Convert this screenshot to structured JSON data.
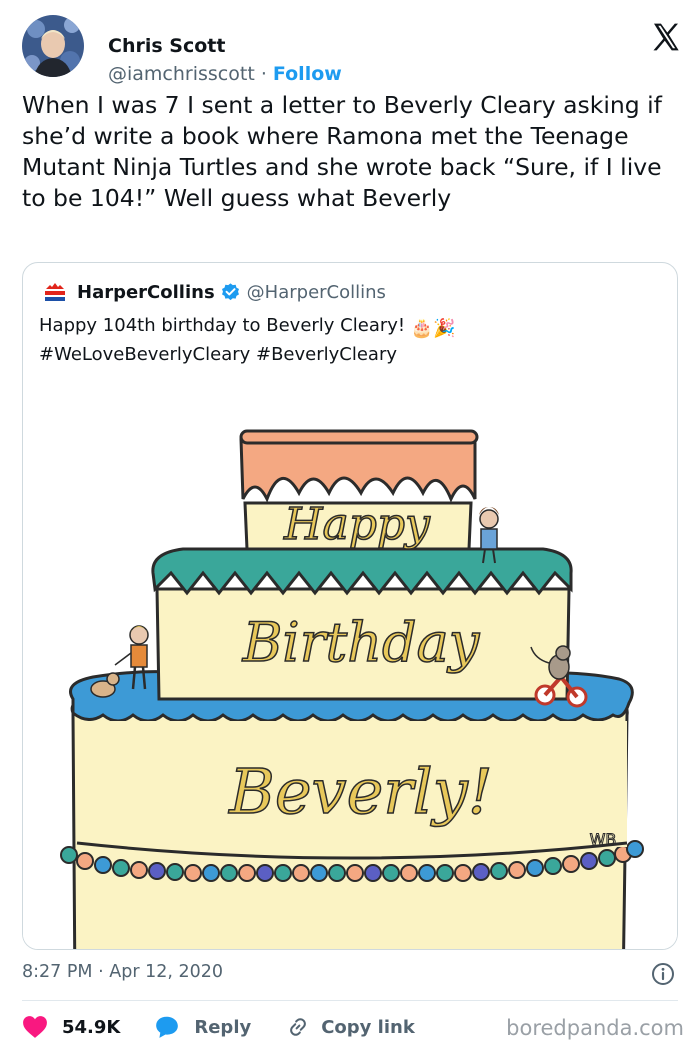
{
  "author": {
    "name": "Chris Scott",
    "handle": "@iamchrisscott",
    "separator": "·",
    "follow_label": "Follow"
  },
  "tweet": {
    "text": "When I was 7 I sent a letter to Beverly Cleary asking if she’d write a book where Ramona met the Teenage Mutant Ninja Turtles and she wrote back “Sure, if I live to be 104!” Well guess what Beverly"
  },
  "quote": {
    "name": "HarperCollins",
    "handle": "@HarperCollins",
    "text_line1": "Happy 104th birthday to Beverly Cleary!",
    "text_line2": "#WeLoveBeverlyCleary #BeverlyCleary",
    "emoji": "🎂🎉",
    "image": {
      "line1": "Happy",
      "line2": "Birthday",
      "line3": "Beverly!",
      "signature": "WB"
    }
  },
  "meta": {
    "time": "8:27 PM",
    "separator": "·",
    "date": "Apr 12, 2020"
  },
  "actions": {
    "like_count": "54.9K",
    "reply_label": "Reply",
    "copy_label": "Copy link"
  },
  "watermark": "boredpanda.com",
  "colors": {
    "like": "#f91880",
    "reply": "#1d9bf0",
    "follow": "#1d9bf0",
    "cake_top": "#f4a882",
    "cake_middle": "#3aa79a",
    "cake_bottom": "#3d9ad6",
    "cake_body": "#fbf3c4"
  }
}
